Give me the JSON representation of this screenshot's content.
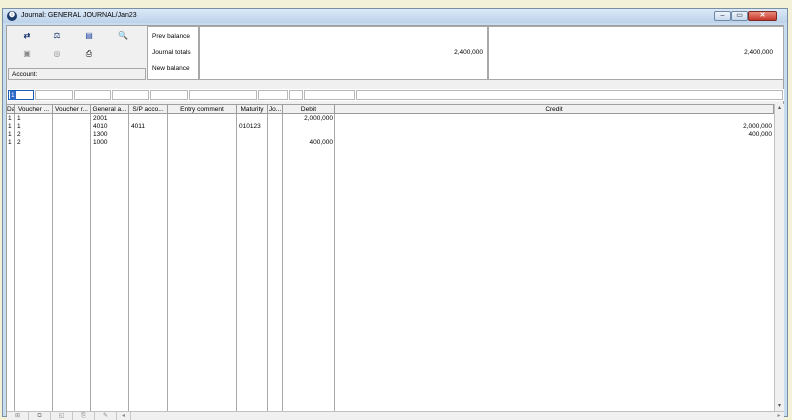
{
  "window": {
    "title": "Journal: GENERAL JOURNAL/Jan23",
    "controls": {
      "minimize": "‒",
      "maximize": "▭",
      "close": "✕"
    }
  },
  "toolbar": {
    "buttons": [
      {
        "name": "transfer-icon",
        "glyph": "⇄"
      },
      {
        "name": "balance-icon",
        "glyph": "⚖"
      },
      {
        "name": "book-icon",
        "glyph": "▤"
      },
      {
        "name": "search-icon",
        "glyph": "🔍"
      },
      {
        "name": "preview-icon",
        "glyph": "▣"
      },
      {
        "name": "find-icon",
        "glyph": "◎"
      },
      {
        "name": "print-icon",
        "glyph": "⎙"
      }
    ],
    "account_label": "Account:"
  },
  "summary": {
    "labels": [
      "Prev balance",
      "Journal totals",
      "New balance"
    ],
    "debit_total": "2,400,000",
    "credit_total": "2,400,000"
  },
  "entry": {
    "day_value": "1"
  },
  "grid": {
    "columns": [
      "Day",
      "Voucher ...",
      "Voucher r...",
      "General a...",
      "S/P acco...",
      "Entry comment",
      "Maturity",
      "Jo...",
      "Debit",
      "Credit"
    ],
    "rows": [
      {
        "day": "1",
        "voucher": "1",
        "voucher_ref": "",
        "general_account": "2001",
        "sp_account": "",
        "comment": "",
        "maturity": "",
        "jo": "",
        "debit": "2,000,000",
        "credit": ""
      },
      {
        "day": "1",
        "voucher": "1",
        "voucher_ref": "",
        "general_account": "4010",
        "sp_account": "4011",
        "comment": "",
        "maturity": "010123",
        "jo": "",
        "debit": "",
        "credit": "2,000,000"
      },
      {
        "day": "1",
        "voucher": "2",
        "voucher_ref": "",
        "general_account": "1300",
        "sp_account": "",
        "comment": "",
        "maturity": "",
        "jo": "",
        "debit": "",
        "credit": "400,000"
      },
      {
        "day": "1",
        "voucher": "2",
        "voucher_ref": "",
        "general_account": "1000",
        "sp_account": "",
        "comment": "",
        "maturity": "",
        "jo": "",
        "debit": "400,000",
        "credit": ""
      }
    ]
  },
  "bottom_toolbar": {
    "buttons": [
      {
        "name": "add-row-icon",
        "glyph": "⊞"
      },
      {
        "name": "copy-row-icon",
        "glyph": "⧉"
      },
      {
        "name": "view-row-icon",
        "glyph": "◱"
      },
      {
        "name": "attach-icon",
        "glyph": "⎘"
      },
      {
        "name": "edit-row-icon",
        "glyph": "✎"
      }
    ],
    "scroll_left": "◂",
    "scroll_right": "▸"
  },
  "scrollbar": {
    "up": "▴",
    "down": "▾"
  },
  "colors": {
    "frame": "#c8dcf0",
    "selection": "#2e68c9",
    "close": "#c6382a"
  }
}
